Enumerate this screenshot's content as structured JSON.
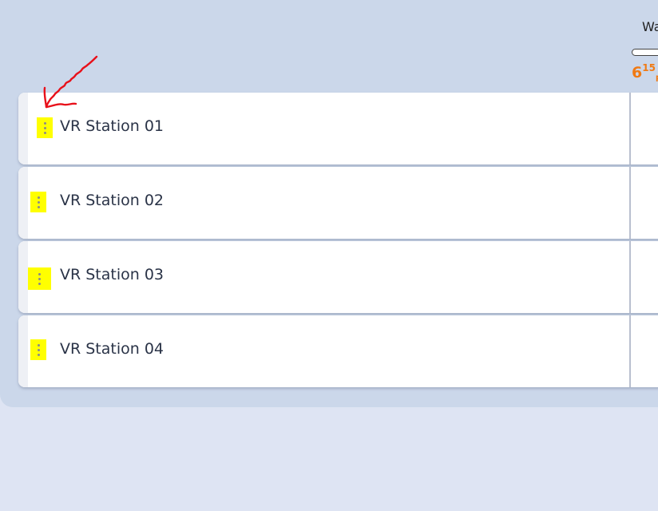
{
  "header": {
    "column_label": "Wa",
    "time": {
      "hour": "6",
      "minutes": "15",
      "ampm": "pm"
    }
  },
  "stations": [
    {
      "name": "VR Station 01"
    },
    {
      "name": "VR Station 02"
    },
    {
      "name": "VR Station 03"
    },
    {
      "name": "VR Station 04"
    }
  ],
  "icons": {
    "drag_handle": "drag-handle-icon",
    "annotation": "red-arrow-icon"
  },
  "colors": {
    "panel_bg": "#cbd7ea",
    "page_bg": "#dee4f3",
    "time_accent": "#f07a14",
    "handle_highlight": "#ffff00",
    "annotation": "#e8101a"
  }
}
